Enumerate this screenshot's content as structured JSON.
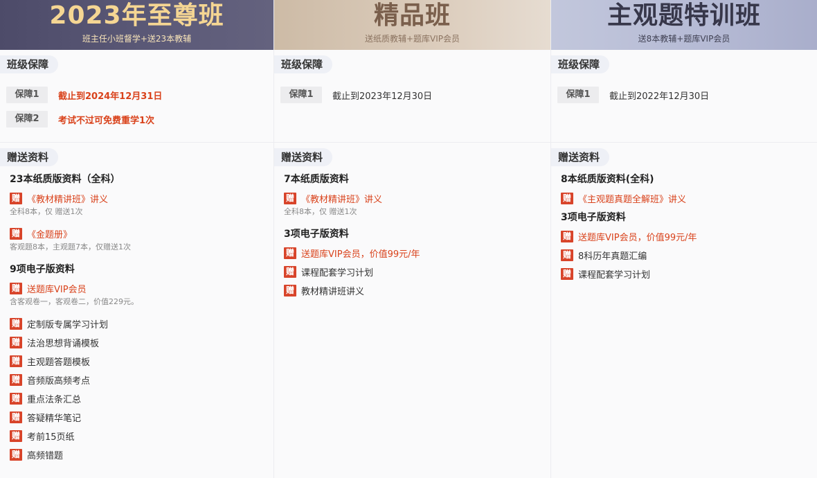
{
  "columns": [
    {
      "title": "2023年至尊班",
      "subtitle": "班主任小班督学+送23本教辅",
      "guarantee_label": "班级保障",
      "guarantees": [
        {
          "tag": "保障1",
          "text": "截止到2024年12月31日"
        },
        {
          "tag": "保障2",
          "text": "考试不过可免费重学1次"
        }
      ],
      "gift_label": "赠送资料",
      "gift_groups": [
        {
          "heading": "23本纸质版资料（全科）",
          "items": [
            {
              "badge": "赠",
              "text": "《教材精讲班》讲义",
              "note": "全科8本，仅 赠送1次"
            },
            {
              "badge": "赠",
              "text": "《金题册》",
              "note": "客观题8本，主观题7本，仅赠送1次"
            }
          ]
        },
        {
          "heading": "9项电子版资料",
          "items": [
            {
              "badge": "赠",
              "text": "送题库VIP会员",
              "note": "含客观卷一，客观卷二，价值229元。"
            },
            {
              "badge": "赠",
              "text": "定制版专属学习计划"
            },
            {
              "badge": "赠",
              "text": "法治思想背诵模板"
            },
            {
              "badge": "赠",
              "text": "主观题答题模板"
            },
            {
              "badge": "赠",
              "text": "音频版高频考点"
            },
            {
              "badge": "赠",
              "text": "重点法条汇总"
            },
            {
              "badge": "赠",
              "text": "答疑精华笔记"
            },
            {
              "badge": "赠",
              "text": "考前15页纸"
            },
            {
              "badge": "赠",
              "text": "高频错题"
            }
          ]
        }
      ]
    },
    {
      "title": "精品班",
      "subtitle": "送纸质教辅+题库VIP会员",
      "guarantee_label": "班级保障",
      "guarantees": [
        {
          "tag": "保障1",
          "text": "截止到2023年12月30日"
        }
      ],
      "gift_label": "赠送资料",
      "gift_groups": [
        {
          "heading": "7本纸质版资料",
          "items": [
            {
              "badge": "赠",
              "text": "《教材精讲班》讲义",
              "note": "全科8本，仅 赠送1次"
            }
          ]
        },
        {
          "heading": "3项电子版资料",
          "items": [
            {
              "badge": "赠",
              "text": "送题库VIP会员，价值99元/年"
            },
            {
              "badge": "赠",
              "text": "课程配套学习计划"
            },
            {
              "badge": "赠",
              "text": "教材精讲班讲义"
            }
          ]
        }
      ]
    },
    {
      "title": "主观题特训班",
      "subtitle": "送8本教辅+题库VIP会员",
      "guarantee_label": "班级保障",
      "guarantees": [
        {
          "tag": "保障1",
          "text": "截止到2022年12月30日"
        }
      ],
      "gift_label": "赠送资料",
      "gift_groups": [
        {
          "heading": "8本纸质版资料(全科)",
          "items": [
            {
              "badge": "赠",
              "text": "《主观题真题全解班》讲义"
            }
          ]
        },
        {
          "heading": "3项电子版资料",
          "items": [
            {
              "badge": "赠",
              "text": "送题库VIP会员，价值99元/年"
            },
            {
              "badge": "赠",
              "text": "8科历年真题汇编"
            },
            {
              "badge": "赠",
              "text": "课程配套学习计划"
            }
          ]
        }
      ]
    }
  ]
}
